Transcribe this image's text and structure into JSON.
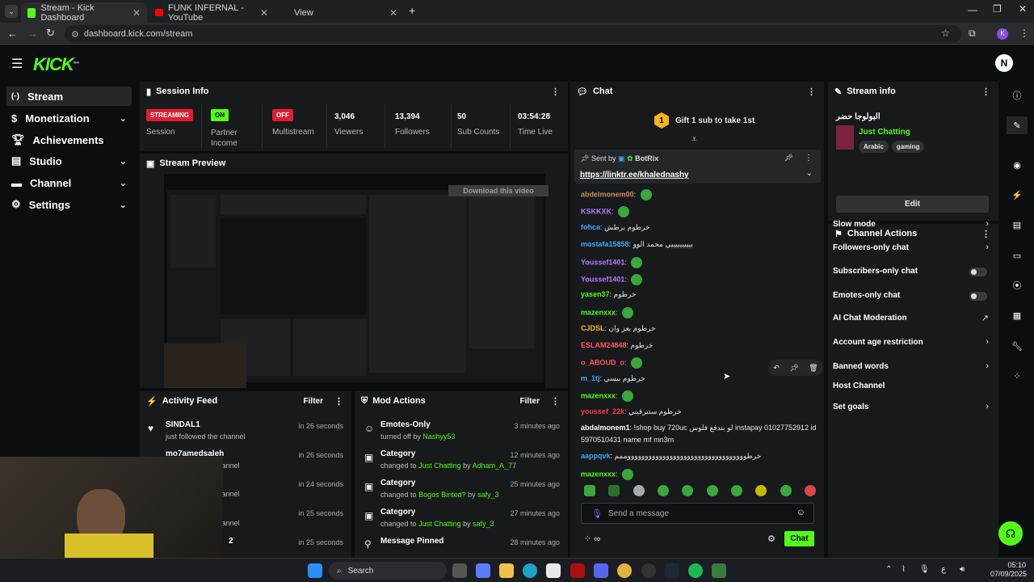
{
  "browser": {
    "tabs": [
      {
        "title": "Stream - Kick Dashboard"
      },
      {
        "title": "FUNK INFERNAL - YouTube"
      },
      {
        "title": "View"
      }
    ],
    "url": "dashboard.kick.com/stream",
    "profile_letter": "K"
  },
  "app": {
    "logo": "KICK",
    "logo_tag": "BETA",
    "nav": [
      {
        "label": "Stream"
      },
      {
        "label": "Monetization"
      },
      {
        "label": "Achievements"
      },
      {
        "label": "Studio"
      },
      {
        "label": "Channel"
      },
      {
        "label": "Settings"
      }
    ]
  },
  "session": {
    "title": "Session Info",
    "status_badge": "STREAMING",
    "session_label": "Session",
    "partner_badge": "ON",
    "partner_label": "Partner Income",
    "multistream_badge": "OFF",
    "multistream_label": "Multistream",
    "viewers_value": "3,046",
    "viewers_label": "Viewers",
    "followers_value": "13,394",
    "followers_label": "Followers",
    "subs_value": "50",
    "subs_label": "Sub Counts",
    "time_value": "03:54:28",
    "time_label": "Time Live"
  },
  "preview": {
    "title": "Stream Preview",
    "download_label": "Download this video"
  },
  "activity": {
    "title": "Activity Feed",
    "filter": "Filter",
    "items": [
      {
        "name": "SINDAL1",
        "sub": "just followed the channel",
        "time": "in 26 seconds"
      },
      {
        "name": "mo7amedsaleh",
        "sub": "channel",
        "time": "in 26 seconds"
      },
      {
        "name": "",
        "sub": "channel",
        "time": "in 24 seconds"
      },
      {
        "name": "",
        "sub": "channel",
        "time": "in 25 seconds"
      },
      {
        "name": "2",
        "sub": "",
        "time": "in 25 seconds"
      }
    ]
  },
  "mod": {
    "title": "Mod Actions",
    "filter": "Filter",
    "items": [
      {
        "title": "Emotes-Only",
        "sub": "turned off by",
        "who": "Nashyy53",
        "time": "3 minutes ago"
      },
      {
        "title": "Category",
        "sub": "changed to",
        "cat": "Just Chatting",
        "by": "by",
        "who": "Adham_A_77",
        "time": "12 minutes ago"
      },
      {
        "title": "Category",
        "sub": "changed to",
        "cat": "Bogos Binted?",
        "by": "by",
        "who": "safy_3",
        "time": "25 minutes ago"
      },
      {
        "title": "Category",
        "sub": "changed to",
        "cat": "Just Chatting",
        "by": "by",
        "who": "safy_3",
        "time": "27 minutes ago"
      },
      {
        "title": "Message Pinned",
        "sub": "",
        "time": "28 minutes ago"
      }
    ]
  },
  "chat": {
    "title": "Chat",
    "gift_text": "Gift 1 sub to take 1st",
    "pinned_sent_by": "Sent by",
    "pinned_user": "BotRix",
    "pinned_link": "https://linktr.ee/khalednashy",
    "messages": [
      {
        "user": "abdelmonem00",
        "text": "",
        "color": "#c98f5a"
      },
      {
        "user": "KSKKXK",
        "text": "",
        "color": "#b27cff"
      },
      {
        "user": "fohca",
        "text": "خرطوم برطش",
        "color": "#3fa7ff"
      },
      {
        "user": "mostafa15858",
        "text": "ييييييييييي محمد الوو",
        "color": "#3fa7ff"
      },
      {
        "user": "Youssef1401",
        "text": "",
        "color": "#b27cff"
      },
      {
        "user": "Youssef1401",
        "text": "",
        "color": "#b27cff"
      },
      {
        "user": "yasen37",
        "text": "خرطوم",
        "color": "#53fc18"
      },
      {
        "user": "mazenxxx",
        "text": "",
        "color": "#53fc18"
      },
      {
        "user": "CJDSL",
        "text": "خرطوم بعز وان",
        "color": "#ffb13b"
      },
      {
        "user": "ESLAM24848",
        "text": "خرطوم",
        "color": "#ff5a5a"
      },
      {
        "user": "o_ABOUD_o",
        "text": "",
        "color": "#ff5a5a"
      },
      {
        "user": "m_1tj",
        "text": "خرطوم بيسي",
        "color": "#3fa7ff"
      },
      {
        "user": "mazenxxx",
        "text": "",
        "color": "#53fc18"
      },
      {
        "user": "youssef_22k",
        "text": "خرطوم ستترقيني",
        "color": "#ff3b3b"
      },
      {
        "user": "abdalmonem1",
        "text": "!shop buy 720uc لو بتدفع فلوس instapay 01027752912 id",
        "color": "#ffffff"
      },
      {
        "user": "",
        "text": "5970510431 name mf mn3m",
        "color": "#ffffff"
      },
      {
        "user": "aappqvk",
        "text": "خرطووووووووووووووووووووووووووووووووووممم",
        "color": "#3fa7ff"
      },
      {
        "user": "mazenxxx",
        "text": "",
        "color": "#53fc18"
      }
    ],
    "input_placeholder": "Send a message",
    "send_label": "Chat"
  },
  "stream_info": {
    "title": "Stream info",
    "stream_title": "البولوجا حضر",
    "category": "Just Chatting",
    "tags": [
      "Arabic",
      "gaming"
    ],
    "edit_label": "Edit"
  },
  "channel_actions": {
    "title": "Channel Actions",
    "items": [
      {
        "label": "Slow mode",
        "control": "arrow"
      },
      {
        "label": "Followers-only chat",
        "control": "arrow"
      },
      {
        "label": "Subscribers-only chat",
        "control": "toggle"
      },
      {
        "label": "Emotes-only chat",
        "control": "toggle"
      },
      {
        "label": "AI Chat Moderation",
        "control": "external"
      },
      {
        "label": "Account age restriction",
        "control": "arrow"
      },
      {
        "label": "Banned words",
        "control": "arrow"
      },
      {
        "label": "Host Channel",
        "control": "none"
      },
      {
        "label": "Set goals",
        "control": "arrow"
      }
    ]
  },
  "taskbar": {
    "search_label": "Search",
    "time": "05:10",
    "date": "07/09/2025",
    "lang": "ع"
  },
  "colors": {
    "accent": "#53fc18",
    "streaming_red": "#e11d2e",
    "panel": "#17191b"
  }
}
